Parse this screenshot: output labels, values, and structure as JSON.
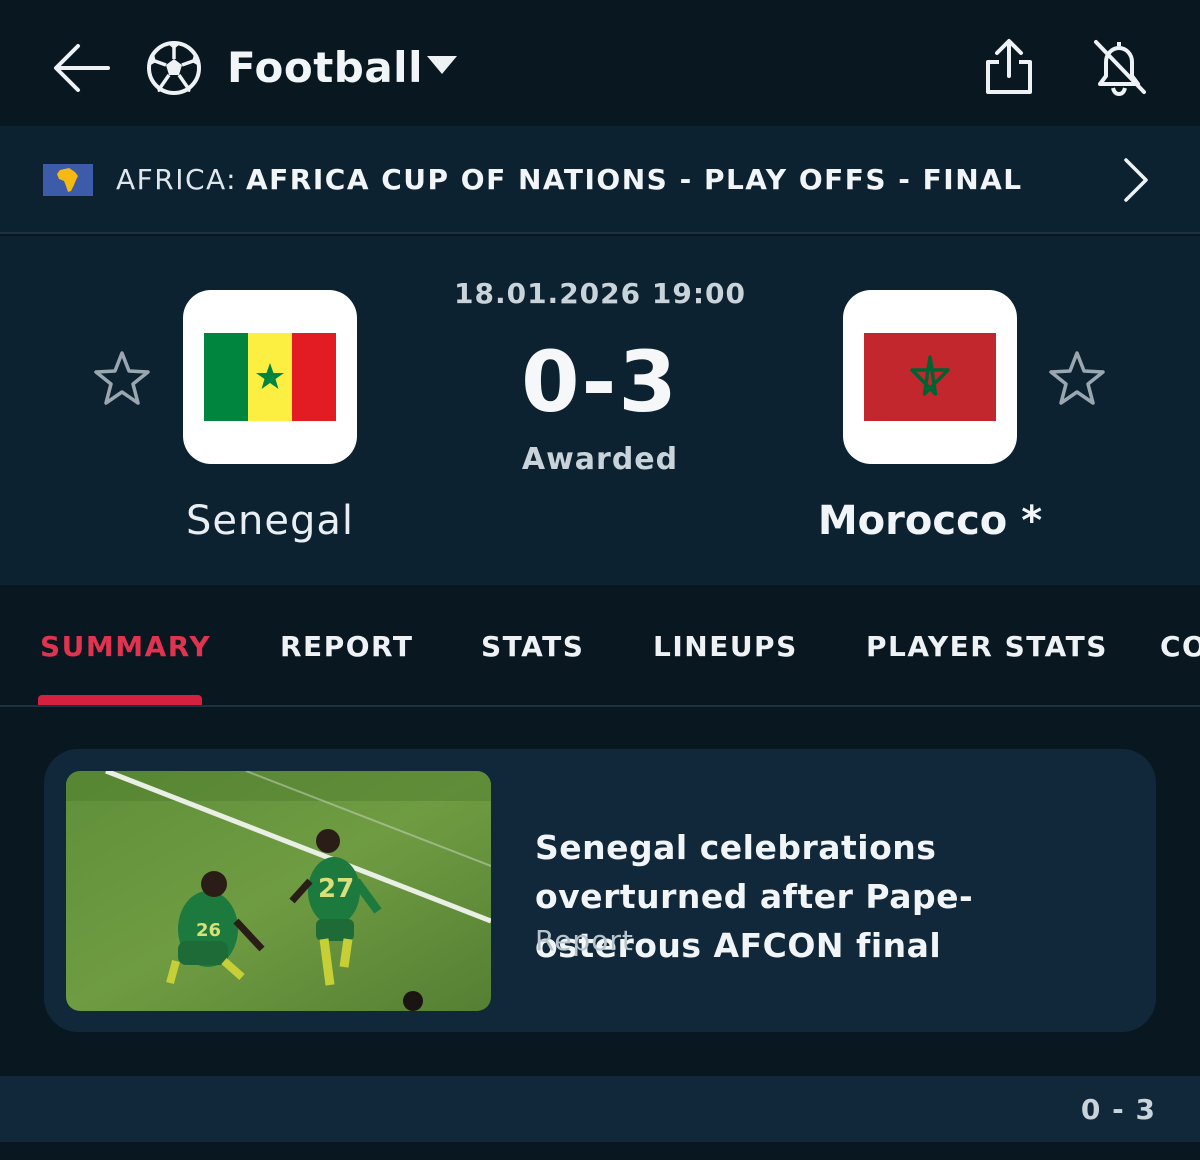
{
  "header": {
    "sport_title": "Football",
    "icons": {
      "back": "back-arrow-icon",
      "sport": "soccer-ball-icon",
      "caret": "caret-down-icon",
      "share": "share-icon",
      "notifications": "bell-off-icon"
    }
  },
  "league": {
    "country": "AFRICA:",
    "name": "AFRICA CUP OF NATIONS - PLAY OFFS - FINAL",
    "icon": "africa-flag-icon"
  },
  "match": {
    "date": "18.01.2026 19:00",
    "score": "0-3",
    "status": "Awarded",
    "home": {
      "name": "Senegal",
      "flag_colors": [
        "#00853f",
        "#fdef42",
        "#e31b23"
      ],
      "favorite_icon": "star-outline-icon"
    },
    "away": {
      "name": "Morocco *",
      "flag_colors": [
        "#c1272d",
        "#006233"
      ],
      "favorite_icon": "star-outline-icon"
    }
  },
  "tabs": [
    {
      "label": "SUMMARY",
      "active": true
    },
    {
      "label": "REPORT"
    },
    {
      "label": "STATS"
    },
    {
      "label": "LINEUPS"
    },
    {
      "label": "PLAYER STATS"
    },
    {
      "label": "CO"
    }
  ],
  "news": {
    "headline": "Senegal celebrations overturned after Pape-osterous AFCON final",
    "type": "Report"
  },
  "bottom": {
    "score": "0 - 3"
  },
  "colors": {
    "background": "#081720",
    "panel": "#0d2230",
    "card": "#10283a",
    "accent": "#d6203f"
  }
}
